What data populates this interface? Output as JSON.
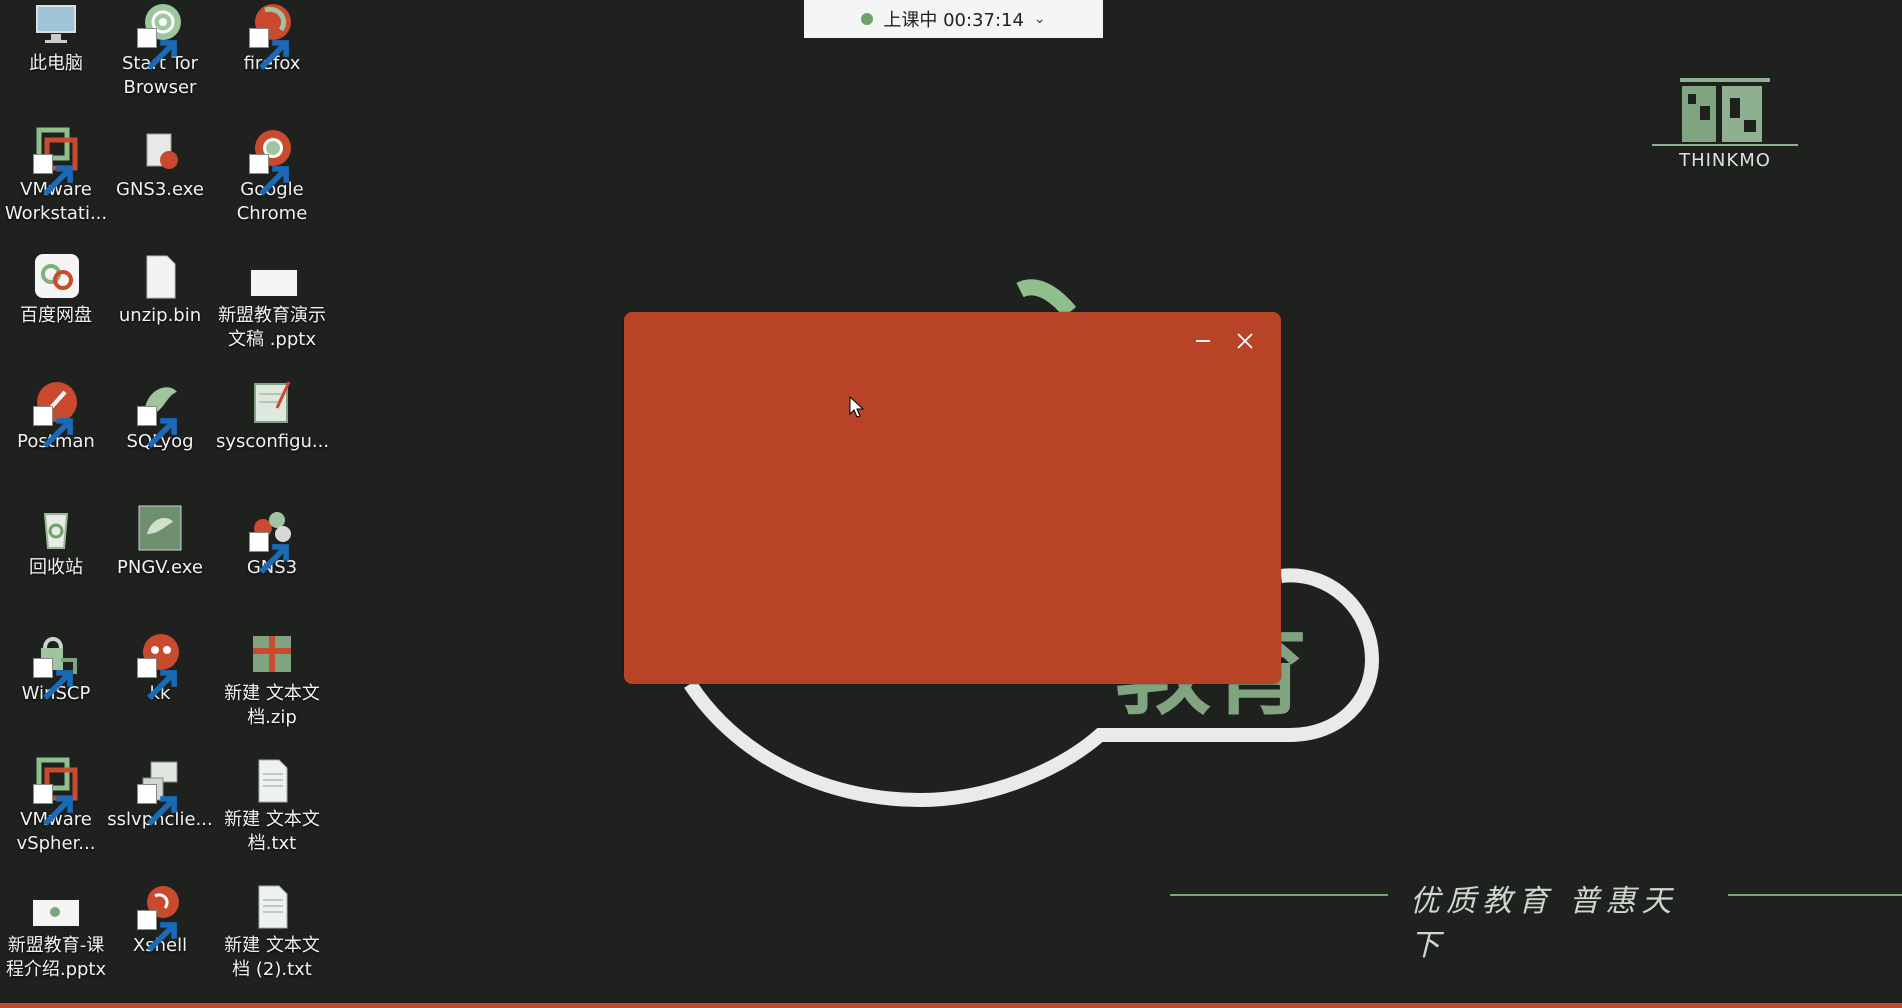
{
  "desktop": {
    "icons": [
      {
        "label": "此电脑",
        "icon": "computer-icon"
      },
      {
        "label": "Start Tor Browser",
        "icon": "tor-icon"
      },
      {
        "label": "firefox",
        "icon": "firefox-icon"
      },
      {
        "label": "VMware Workstati...",
        "icon": "vmware-icon"
      },
      {
        "label": "GNS3.exe",
        "icon": "gns3-exe-icon"
      },
      {
        "label": "Google Chrome",
        "icon": "chrome-icon"
      },
      {
        "label": "百度网盘",
        "icon": "baidu-netdisk-icon"
      },
      {
        "label": "unzip.bin",
        "icon": "file-icon"
      },
      {
        "label": "新盟教育演示文稿 .pptx",
        "icon": "pptx-icon"
      },
      {
        "label": "Postman",
        "icon": "postman-icon"
      },
      {
        "label": "SQLyog",
        "icon": "sqlyog-icon"
      },
      {
        "label": "sysconfigu...",
        "icon": "sysconfig-icon"
      },
      {
        "label": "回收站",
        "icon": "recycle-bin-icon"
      },
      {
        "label": "PNGV.exe",
        "icon": "png-icon"
      },
      {
        "label": "GNS3",
        "icon": "gns3-icon"
      },
      {
        "label": "WinSCP",
        "icon": "winscp-icon"
      },
      {
        "label": "kk",
        "icon": "kk-icon"
      },
      {
        "label": "新建 文本文档.zip",
        "icon": "zip-icon"
      },
      {
        "label": "VMware vSpher...",
        "icon": "vsphere-icon"
      },
      {
        "label": "sslvpnclie...",
        "icon": "sslvpn-icon"
      },
      {
        "label": "新建 文本文档.txt",
        "icon": "txt-icon"
      },
      {
        "label": "新盟教育-课程介绍.pptx",
        "icon": "pptx-icon"
      },
      {
        "label": "Xshell",
        "icon": "xshell-icon"
      },
      {
        "label": "新建 文本文档 (2).txt",
        "icon": "txt-icon"
      }
    ]
  },
  "class_timer": {
    "status": "上课中 00:37:14"
  },
  "brand": {
    "name": "THINKMO"
  },
  "slogan": {
    "text": "优质教育 普惠天下"
  },
  "colors": {
    "background": "#1f211f",
    "window": "#b84326",
    "accent_green": "#6fa36a"
  }
}
